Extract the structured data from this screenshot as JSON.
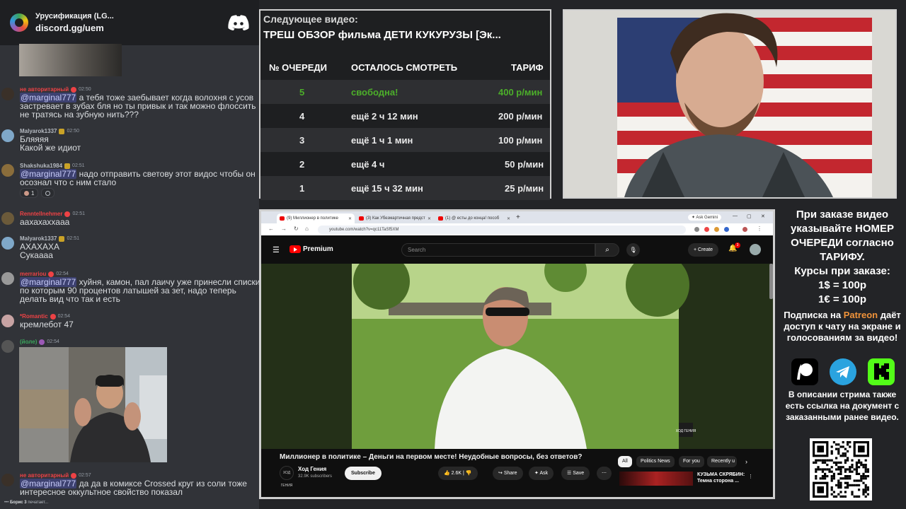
{
  "discord": {
    "server_name": "Урусификация (LG...",
    "invite": "discord.gg/uem",
    "typing": {
      "name": "Борис 3",
      "text": "печатает..."
    },
    "messages": [
      {
        "user": "не авторитарный",
        "user_color": "#ed4245",
        "time": "02:50",
        "mention": "@marginal777",
        "text": " а тебя тоже заебывает когда волохня с усов застревает в зубах бля но ты привык и так можно флоссить не тратясь на зубную нить???"
      },
      {
        "user": "Malyarok1337",
        "user_color": "#b5bac1",
        "time": "02:50",
        "line1": "Бляяяя",
        "line2": "Какой же идиот"
      },
      {
        "user": "Shakshuka1984",
        "user_color": "#b5bac1",
        "time": "02:51",
        "mention": "@marginal777",
        "text": " надо отправить светову этот видос чтобы он осознал что с ним стало",
        "reaction_count": "1"
      },
      {
        "user": "Renntellnehmer",
        "user_color": "#ed4245",
        "time": "02:51",
        "text": "аахахаххааа"
      },
      {
        "user": "Malyarok1337",
        "user_color": "#b5bac1",
        "time": "02:51",
        "line1": "АХАХАХА",
        "line2": "Сукаааа"
      },
      {
        "user": "merrariou",
        "user_color": "#ed4245",
        "time": "02:54",
        "mention": "@marginal777",
        "text": " хуйня, камон, пал лаичу уже принесли списки по которым 90 процентов латышей за зет, надо теперь делать вид что так и есть"
      },
      {
        "user": "*Romantic",
        "user_color": "#ed4245",
        "time": "02:54",
        "text": "кремлебот 47"
      },
      {
        "user": "(йоле)",
        "user_color": "#3ba55c",
        "time": "02:54"
      },
      {
        "user": "не авторитарный",
        "user_color": "#ed4245",
        "time": "02:57",
        "mention": "@marginal777",
        "text": " да да в комиксе Crossed круг из соли тоже интересное оккультное свойство показал"
      }
    ]
  },
  "queue": {
    "next_label": "Следующее видео:",
    "next_title": "ТРЕШ ОБЗОР фильма ДЕТИ КУКУРУЗЫ [Эк...",
    "headers": {
      "num": "№ ОЧЕРЕДИ",
      "remaining": "ОСТАЛОСЬ СМОТРЕТЬ",
      "rate": "ТАРИФ"
    },
    "rows": [
      {
        "num": "5",
        "remaining": "свободна!",
        "rate": "400 р/мин"
      },
      {
        "num": "4",
        "remaining": "ещё 2 ч 12 мин",
        "rate": "200 р/мин"
      },
      {
        "num": "3",
        "remaining": "ещё 1 ч 1 мин",
        "rate": "100 р/мин"
      },
      {
        "num": "2",
        "remaining": "ещё 4 ч",
        "rate": "50 р/мин"
      },
      {
        "num": "1",
        "remaining": "ещё 15 ч 32 мин",
        "rate": "25 р/мин"
      }
    ]
  },
  "browser": {
    "tabs": [
      {
        "label": "(9) Миллионер в политике"
      },
      {
        "label": "(3) Как Убезмартичная предст"
      },
      {
        "label": "(1) @ есты до конца! пособ"
      }
    ],
    "ask_gemini": "Ask Gemini",
    "url": "youtube.com/watch?v=qc11TaSf5XM",
    "youtube": {
      "logo": "Premium",
      "search_placeholder": "Search",
      "create": "Create",
      "notifications": "3",
      "video_title": "Миллионер в политике – Деньги на первом месте! Неудобные вопросы, без ответов?",
      "channel_logo": "ХОД ГЕНИЯ",
      "channel": "Ход Гения",
      "subscribers": "32.9K subscribers",
      "subscribe": "Subscribe",
      "likes": "2.6K",
      "share": "Share",
      "ask": "Ask",
      "save": "Save",
      "watermark": "ХОД ГЕНИЯ",
      "chips": [
        "All",
        "Politics News",
        "For you",
        "Recently u"
      ],
      "rec_title": "КУЗЬМА СКРЯБИН: Темна сторона ..."
    }
  },
  "info": {
    "order_text": "При заказе видео указывайте НОМЕР ОЧЕРЕДИ согласно ТАРИФУ.",
    "rates_label": "Курсы при заказе:",
    "usd": "1$ = 100р",
    "eur": "1€ = 100р",
    "sub_prefix": "Подписка на",
    "patreon": "Patreon",
    "sub_suffix": "даёт доступ к чату на экране и голосованиям за видео!",
    "desc": "В описании стрима также есть ссылка на документ с заказанными ранее видео."
  },
  "colors": {
    "patreon": "#f0933a",
    "telegram": "#2aa3df",
    "kick": "#53fc18",
    "queue_free": "#4caf2a"
  }
}
